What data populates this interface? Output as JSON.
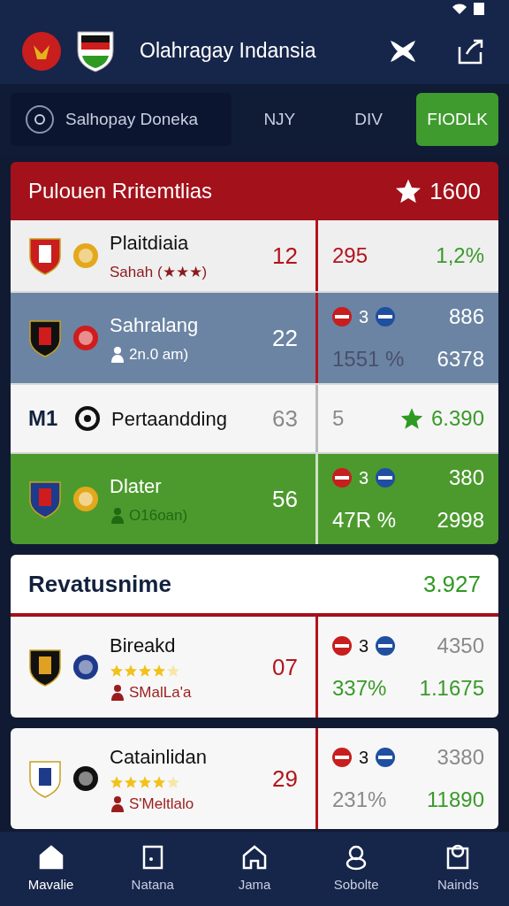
{
  "header": {
    "title": "Olahragay Indansia"
  },
  "search": {
    "placeholder": "Salhopay Doneka"
  },
  "tabs": [
    {
      "label": "NJY",
      "selected": false
    },
    {
      "label": "DIV",
      "selected": false
    },
    {
      "label": "FIODLK",
      "selected": true
    }
  ],
  "sections": [
    {
      "kind": "red",
      "title": "Pulouen Rritemtlias",
      "score": "1600",
      "rows": [
        {
          "kind": "light",
          "name": "Plaitdiaia",
          "subtitle": "Sahah (★★★)",
          "score": {
            "text": "12",
            "color": "#b3141c"
          },
          "lines": [
            {
              "items": [
                {
                  "text": "295",
                  "color": "#b3141c"
                },
                {
                  "text": "1,2%",
                  "color": "#3a9a2a"
                }
              ]
            }
          ]
        },
        {
          "kind": "blue",
          "name": "Sahralang",
          "subtitle": "2n.0 am)",
          "score": {
            "text": "22"
          },
          "lines": [
            {
              "badge": "3",
              "items": [
                {
                  "text": "886"
                }
              ]
            },
            {
              "items": [
                {
                  "text": "1551 %",
                  "color": "#4a4f6a"
                },
                {
                  "text": "6378"
                }
              ]
            }
          ]
        },
        {
          "kind": "plain",
          "lead": "M1",
          "name": "Pertaandding",
          "score": {
            "text": "63",
            "color": "#8a8a8a"
          },
          "lines": [
            {
              "items": [
                {
                  "kind": "plain",
                  "text": "5",
                  "color": "#8a8a8a"
                },
                {
                  "kind": "starred",
                  "text": "6.390",
                  "color": "#3a9a2a"
                }
              ]
            }
          ]
        },
        {
          "kind": "green",
          "name": "Dlater",
          "subtitle": "O16oan)",
          "score": {
            "text": "56"
          },
          "lines": [
            {
              "badge": "3",
              "items": [
                {
                  "text": "380"
                }
              ]
            },
            {
              "items": [
                {
                  "text": "47R %"
                },
                {
                  "text": "2998"
                }
              ]
            }
          ]
        }
      ]
    },
    {
      "kind": "white",
      "title": "Revatusnime",
      "score": "3.927",
      "rows": [
        {
          "kind": "white",
          "name": "Bireakd",
          "stars": 4,
          "subtitle": "SMalLa'a",
          "score": {
            "text": "07",
            "color": "#b3141c"
          },
          "lines": [
            {
              "badge": "3",
              "items": [
                {
                  "text": "4350",
                  "color": "#8a8a8a"
                }
              ]
            },
            {
              "items": [
                {
                  "text": "337%",
                  "color": "#3a9a2a"
                },
                {
                  "text": "1.1675",
                  "color": "#3a9a2a"
                }
              ]
            }
          ]
        }
      ]
    },
    {
      "kind": "none",
      "rows": [
        {
          "kind": "white",
          "name": "Catainlidan",
          "stars": 4,
          "subtitle": "S'Meltlalo",
          "score": {
            "text": "29",
            "color": "#b3141c"
          },
          "lines": [
            {
              "badge": "3",
              "items": [
                {
                  "text": "3380",
                  "color": "#8a8a8a"
                }
              ]
            },
            {
              "items": [
                {
                  "text": "231%",
                  "color": "#8a8a8a"
                },
                {
                  "text": "11890",
                  "color": "#3a9a2a"
                }
              ]
            }
          ]
        }
      ]
    }
  ],
  "nav": [
    {
      "label": "Mavalie",
      "selected": true
    },
    {
      "label": "Natana",
      "selected": false
    },
    {
      "label": "Jama",
      "selected": false
    },
    {
      "label": "Sobolte",
      "selected": false
    },
    {
      "label": "Nainds",
      "selected": false
    }
  ]
}
